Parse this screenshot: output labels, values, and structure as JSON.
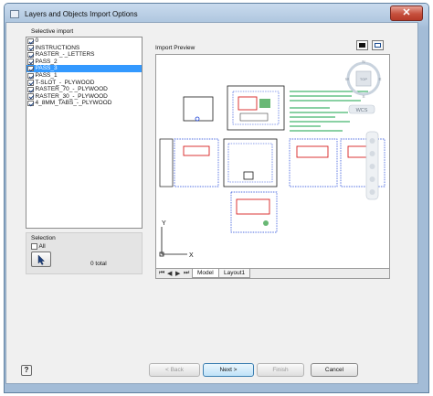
{
  "window": {
    "title": "Layers and Objects Import Options",
    "close_glyph": "✕"
  },
  "selective_import": {
    "label": "Selective import",
    "layers": [
      {
        "name": "0",
        "checked": true,
        "selected": false
      },
      {
        "name": "INSTRUCTIONS",
        "checked": true,
        "selected": false
      },
      {
        "name": "RASTER_-_LETTERS",
        "checked": true,
        "selected": false
      },
      {
        "name": "PASS_2",
        "checked": true,
        "selected": false
      },
      {
        "name": "PASS_3",
        "checked": true,
        "selected": true
      },
      {
        "name": "PASS_1",
        "checked": true,
        "selected": false
      },
      {
        "name": "T-SLOT_-_PLYWOOD",
        "checked": true,
        "selected": false
      },
      {
        "name": "RASTER_70_-_PLYWOOD",
        "checked": true,
        "selected": false
      },
      {
        "name": "RASTER_30_-_PLYWOOD",
        "checked": true,
        "selected": false
      },
      {
        "name": "4_8MM_TABS_-_PLYWOOD",
        "checked": true,
        "selected": false
      }
    ]
  },
  "selection": {
    "label": "Selection",
    "all_label": "All",
    "total_text": "0 total"
  },
  "preview": {
    "label": "Import Preview",
    "viewcube": {
      "top": "TOP",
      "n": "N",
      "w": "W",
      "s": "S",
      "e": "E",
      "wcs": "WCS"
    },
    "axes": {
      "x": "X",
      "y": "Y"
    },
    "tabs": [
      "Model",
      "Layout1"
    ],
    "active_tab": "Model"
  },
  "buttons": {
    "help": "?",
    "back": "< Back",
    "next": "Next >",
    "finish": "Finish",
    "cancel": "Cancel"
  }
}
